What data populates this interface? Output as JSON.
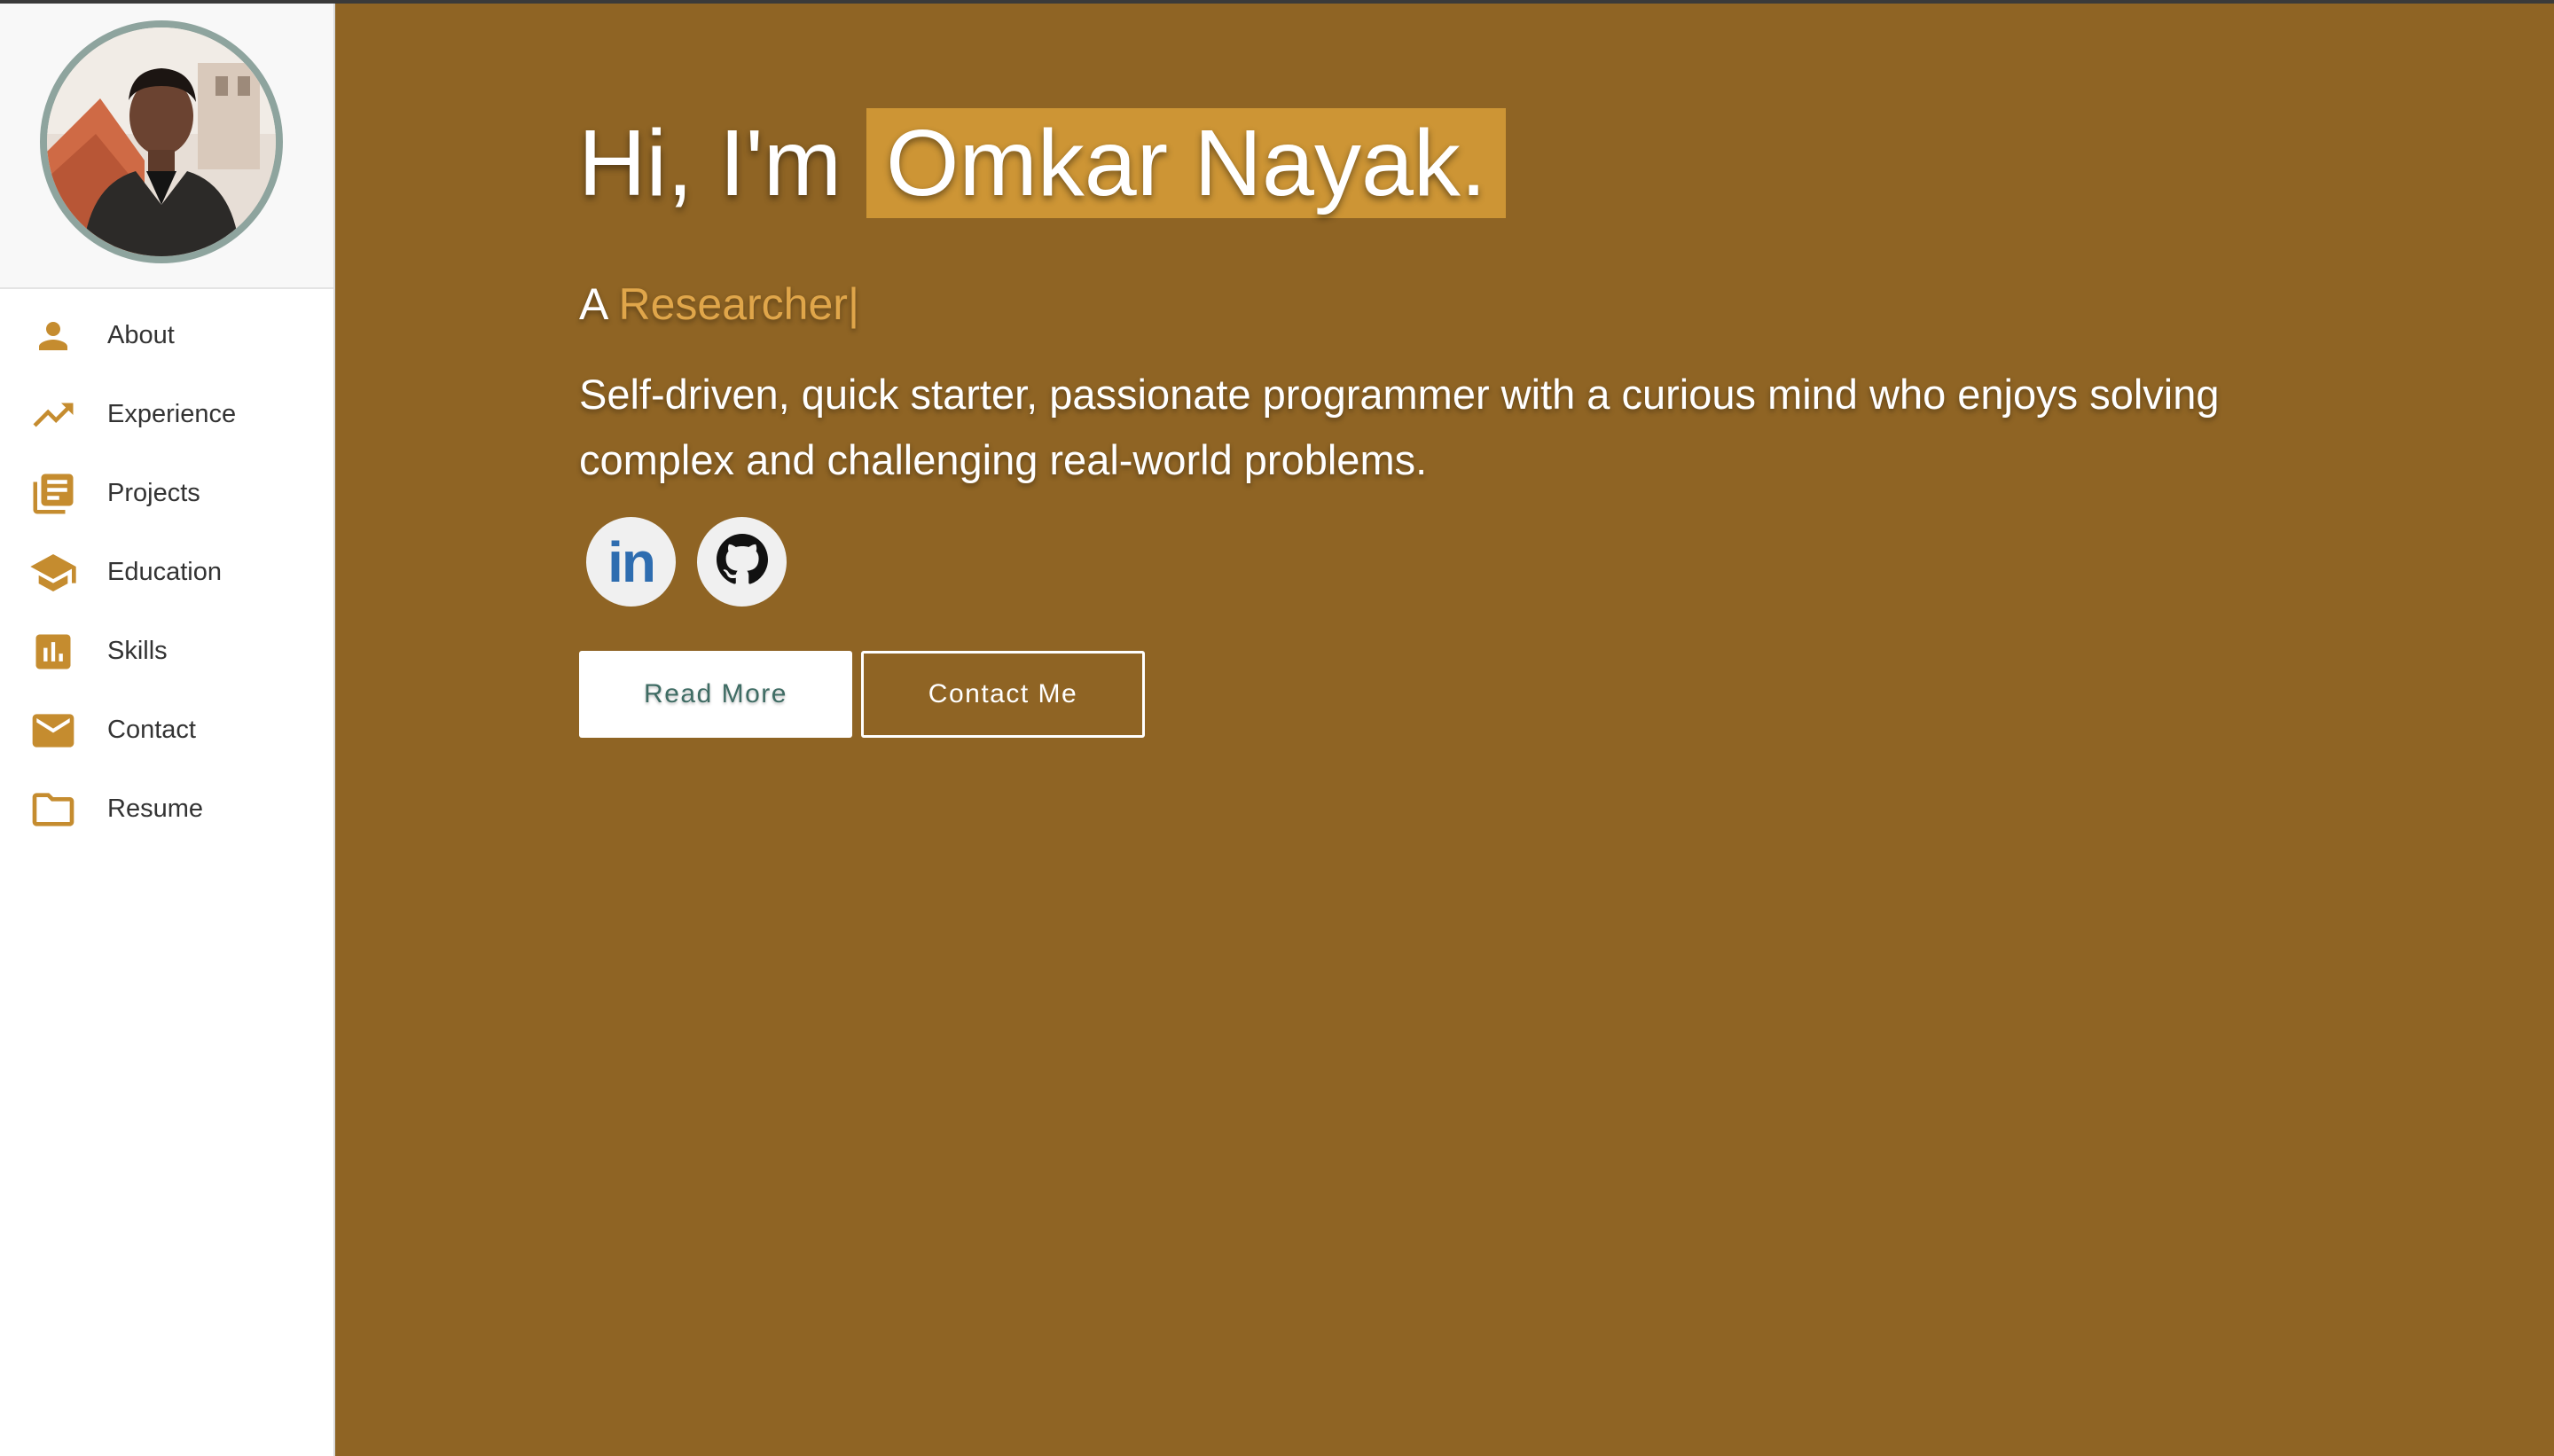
{
  "sidebar": {
    "avatar_alt": "Profile photo",
    "items": [
      {
        "label": "About",
        "icon": "person-icon"
      },
      {
        "label": "Experience",
        "icon": "trending-up-icon"
      },
      {
        "label": "Projects",
        "icon": "library-books-icon"
      },
      {
        "label": "Education",
        "icon": "school-icon"
      },
      {
        "label": "Skills",
        "icon": "bar-chart-icon"
      },
      {
        "label": "Contact",
        "icon": "mail-icon"
      },
      {
        "label": "Resume",
        "icon": "folder-icon"
      }
    ]
  },
  "hero": {
    "greeting": "Hi, I'm",
    "name": "Omkar Nayak.",
    "role_prefix": "A",
    "role": "Researcher",
    "role_caret": "|",
    "intro": "Self-driven, quick starter, passionate programmer with a curious mind who enjoys solving complex and challenging real-world problems.",
    "socials": [
      {
        "name": "LinkedIn",
        "icon": "linkedin-icon",
        "text": "in"
      },
      {
        "name": "GitHub",
        "icon": "github-icon"
      }
    ],
    "buttons": {
      "read_more": "Read More",
      "contact_me": "Contact Me"
    }
  },
  "colors": {
    "background": "#8f6424",
    "accent": "#cd9535",
    "accent_text": "#e0a64a",
    "sidebar_icon": "#c58c2f",
    "avatar_border": "#8ea49e",
    "linkedin": "#2e6db0"
  }
}
